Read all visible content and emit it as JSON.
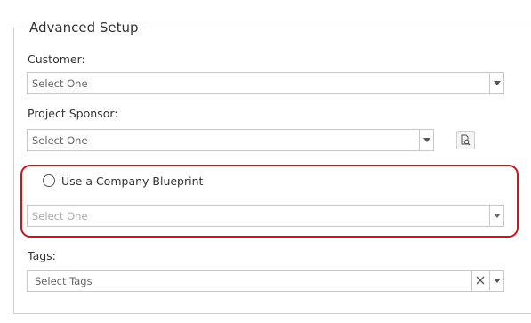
{
  "section": {
    "title": "Advanced Setup"
  },
  "customer": {
    "label": "Customer:",
    "value": "Select One"
  },
  "project_sponsor": {
    "label": "Project Sponsor:",
    "value": "Select One",
    "lookup_icon": "search-document-icon"
  },
  "company_blueprint": {
    "radio_label": "Use a Company Blueprint",
    "selected": false,
    "value": "Select One",
    "enabled": false,
    "highlight_color": "#d0121b"
  },
  "tags": {
    "label": "Tags:",
    "value": "Select Tags",
    "clear_icon": "close-icon"
  },
  "icons": {
    "dropdown": "chevron-down-icon"
  }
}
